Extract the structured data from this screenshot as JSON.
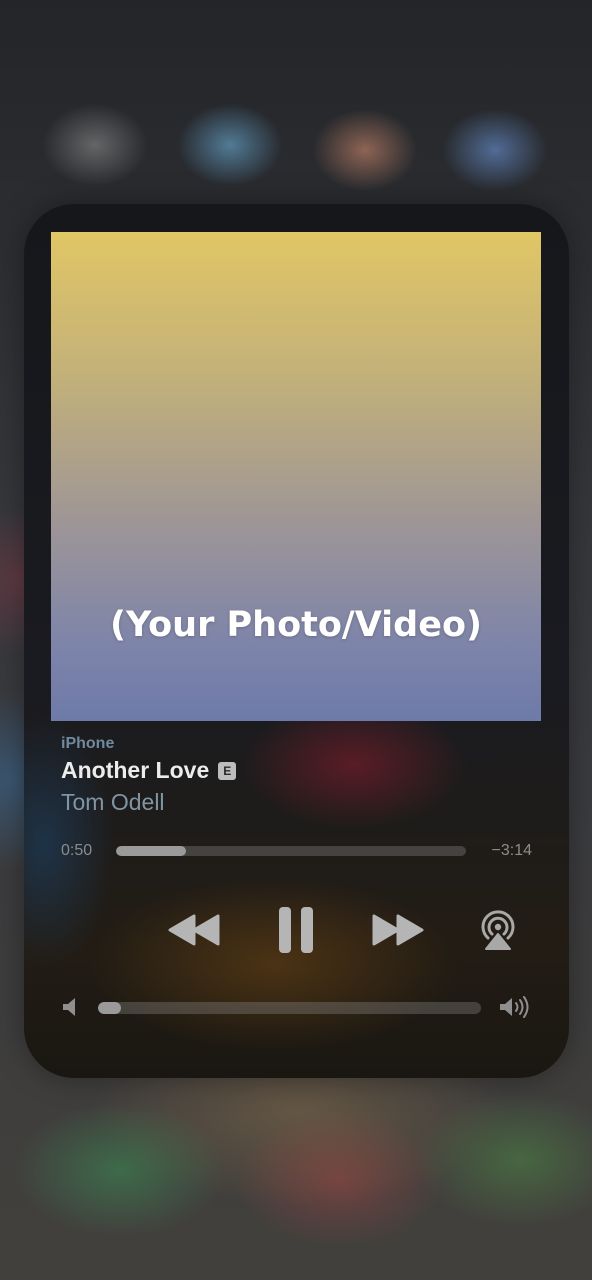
{
  "artwork": {
    "placeholder_text": "(Your Photo/Video)"
  },
  "now_playing": {
    "source": "iPhone",
    "title": "Another Love",
    "explicit_badge": "E",
    "artist": "Tom Odell"
  },
  "playback": {
    "elapsed": "0:50",
    "remaining": "−3:14",
    "progress_fraction": 0.2,
    "state": "playing"
  },
  "volume": {
    "level_fraction": 0.06
  },
  "icons": {
    "rewind": "rewind-icon",
    "pause": "pause-icon",
    "forward": "fast-forward-icon",
    "airplay": "airplay-icon",
    "volume_low": "speaker-low-icon",
    "volume_high": "speaker-high-icon"
  },
  "colors": {
    "artwork_top": "#e1c665",
    "artwork_bottom": "#6e7aa8",
    "source_text": "#6f8a9e",
    "title_text": "#ececec",
    "artist_text": "#7f95a3",
    "control_gray": "#b5b5b5"
  }
}
